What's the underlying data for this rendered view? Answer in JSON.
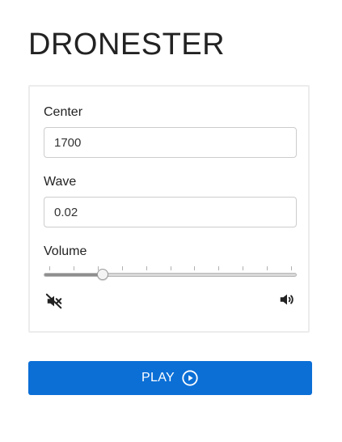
{
  "app": {
    "title": "DRONESTER"
  },
  "controls": {
    "center": {
      "label": "Center",
      "value": "1700"
    },
    "wave": {
      "label": "Wave",
      "value": "0.02"
    },
    "volume": {
      "label": "Volume",
      "level": 0.22,
      "tick_count": 11,
      "mute_icon": "volume-mute-icon",
      "max_icon": "volume-up-icon"
    }
  },
  "play_button": {
    "label": "PLAY",
    "icon": "play-circle-icon",
    "color": "#0b6fd6"
  }
}
